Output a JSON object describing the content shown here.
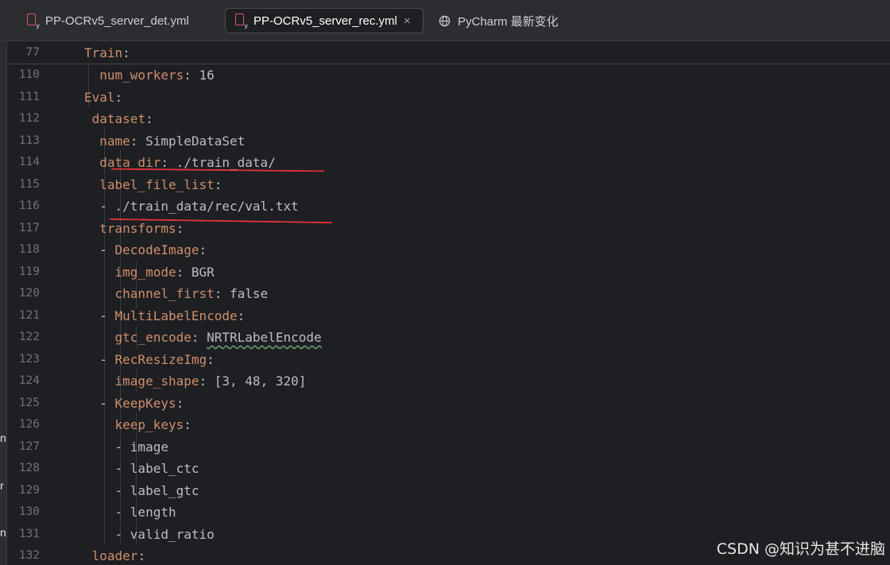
{
  "tabs": [
    {
      "label": "PP-OCRv5_server_det.yml",
      "active": false
    },
    {
      "label": "PP-OCRv5_server_rec.yml",
      "active": true,
      "close": "×"
    },
    {
      "label": "PyCharm 最新变化",
      "active": false
    }
  ],
  "left_glyphs": [
    "n",
    "r",
    "n"
  ],
  "sticky": {
    "ln": "77",
    "key": "Train",
    "punct": ":"
  },
  "lines": [
    {
      "ln": "110",
      "indent": "  ",
      "key": "num_workers",
      "punct": ": ",
      "value": "16"
    },
    {
      "ln": "111",
      "indent": "",
      "key": "Eval",
      "punct": ":",
      "value": ""
    },
    {
      "ln": "112",
      "indent": " ",
      "key": "dataset",
      "punct": ":",
      "value": ""
    },
    {
      "ln": "113",
      "indent": "  ",
      "key": "name",
      "punct": ": ",
      "value": "SimpleDataSet"
    },
    {
      "ln": "114",
      "indent": "  ",
      "key": "data_dir",
      "punct": ": ",
      "value": "./train_data/"
    },
    {
      "ln": "115",
      "indent": "  ",
      "key": "label_file_list",
      "punct": ":",
      "value": ""
    },
    {
      "ln": "116",
      "indent": "  ",
      "dash": "- ",
      "value": "./train_data/rec/val.txt"
    },
    {
      "ln": "117",
      "indent": "  ",
      "key": "transforms",
      "punct": ":",
      "value": ""
    },
    {
      "ln": "118",
      "indent": "  ",
      "dash": "- ",
      "key": "DecodeImage",
      "punct": ":",
      "value": ""
    },
    {
      "ln": "119",
      "indent": "    ",
      "key": "img_mode",
      "punct": ": ",
      "value": "BGR"
    },
    {
      "ln": "120",
      "indent": "    ",
      "key": "channel_first",
      "punct": ": ",
      "value": "false"
    },
    {
      "ln": "121",
      "indent": "  ",
      "dash": "- ",
      "key": "MultiLabelEncode",
      "punct": ":",
      "value": ""
    },
    {
      "ln": "122",
      "indent": "    ",
      "key": "gtc_encode",
      "punct": ": ",
      "value": "NRTRLabelEncode",
      "wavy": true
    },
    {
      "ln": "123",
      "indent": "  ",
      "dash": "- ",
      "key": "RecResizeImg",
      "punct": ":",
      "value": ""
    },
    {
      "ln": "124",
      "indent": "    ",
      "key": "image_shape",
      "punct": ": ",
      "value": "[3, 48, 320]"
    },
    {
      "ln": "125",
      "indent": "  ",
      "dash": "- ",
      "key": "KeepKeys",
      "punct": ":",
      "value": ""
    },
    {
      "ln": "126",
      "indent": "    ",
      "key": "keep_keys",
      "punct": ":",
      "value": ""
    },
    {
      "ln": "127",
      "indent": "    ",
      "dash": "- ",
      "value": "image"
    },
    {
      "ln": "128",
      "indent": "    ",
      "dash": "- ",
      "value": "label_ctc"
    },
    {
      "ln": "129",
      "indent": "    ",
      "dash": "- ",
      "value": "label_gtc"
    },
    {
      "ln": "130",
      "indent": "    ",
      "dash": "- ",
      "value": "length"
    },
    {
      "ln": "131",
      "indent": "    ",
      "dash": "- ",
      "value": "valid_ratio"
    },
    {
      "ln": "132",
      "indent": " ",
      "key": "loader",
      "punct": ":",
      "value": ""
    }
  ],
  "watermark": "CSDN @知识为甚不进脑",
  "colors": {
    "key": "#cf8e6d",
    "annotation": "#e8333a",
    "background": "#1e1f22"
  }
}
